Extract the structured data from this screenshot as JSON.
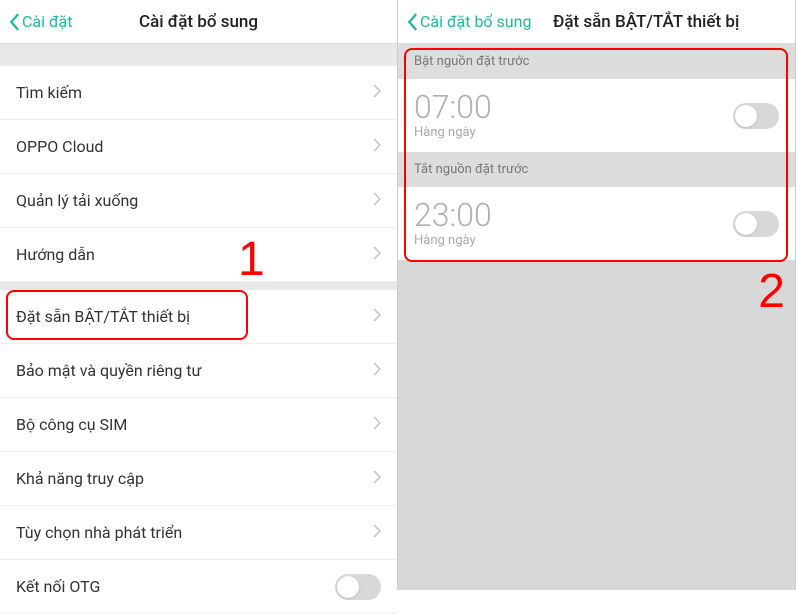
{
  "left": {
    "back_label": "Cài đặt",
    "title": "Cài đặt bổ sung",
    "items": [
      {
        "label": "Tìm kiếm"
      },
      {
        "label": "OPPO Cloud"
      },
      {
        "label": "Quản lý tải xuống"
      },
      {
        "label": "Hướng dẫn"
      },
      {
        "label": "Đặt sẵn BẬT/TẮT thiết bị"
      },
      {
        "label": "Bảo mật và quyền riêng tư"
      },
      {
        "label": "Bộ công cụ SIM"
      },
      {
        "label": "Khả năng truy cập"
      },
      {
        "label": "Tùy chọn nhà phát triển"
      },
      {
        "label": "Kết nối OTG"
      }
    ],
    "annotation": "1"
  },
  "right": {
    "back_label": "Cài đặt bổ sung",
    "title": "Đặt sẵn BẬT/TẮT thiết bị",
    "sections": [
      {
        "header": "Bật nguồn đặt trước",
        "time": "07:00",
        "freq": "Hàng ngày"
      },
      {
        "header": "Tắt nguồn đặt trước",
        "time": "23:00",
        "freq": "Hàng ngày"
      }
    ],
    "annotation": "2"
  }
}
